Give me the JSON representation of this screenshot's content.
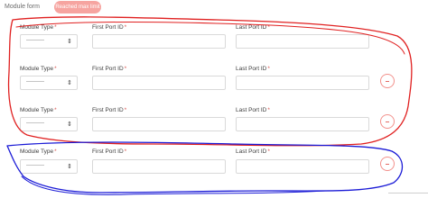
{
  "header": {
    "title": "Module form",
    "limit_badge": "Reached max limit"
  },
  "rows": [
    {
      "module_type_label": "Module Type",
      "module_type_value": "----------",
      "first_port_label": "First Port ID",
      "last_port_label": "Last Port ID",
      "required_mark": "*",
      "has_remove": false
    },
    {
      "module_type_label": "Module Type",
      "module_type_value": "----------",
      "first_port_label": "First Port ID",
      "last_port_label": "Last Port ID",
      "required_mark": "*",
      "has_remove": true
    },
    {
      "module_type_label": "Module Type",
      "module_type_value": "----------",
      "first_port_label": "First Port ID",
      "last_port_label": "Last Port ID",
      "required_mark": "*",
      "has_remove": true
    },
    {
      "module_type_label": "Module Type",
      "module_type_value": "----------",
      "first_port_label": "First Port ID",
      "last_port_label": "Last Port ID",
      "required_mark": "*",
      "has_remove": true
    }
  ],
  "icons": {
    "select_chevron": "chevron-updown-icon",
    "remove": "minus-icon"
  },
  "colors": {
    "badge": "#f6a4a0",
    "required": "#d9534f",
    "remove_border": "#f2908b",
    "annotation_red": "#e02020",
    "annotation_blue": "#1a1ad6"
  }
}
